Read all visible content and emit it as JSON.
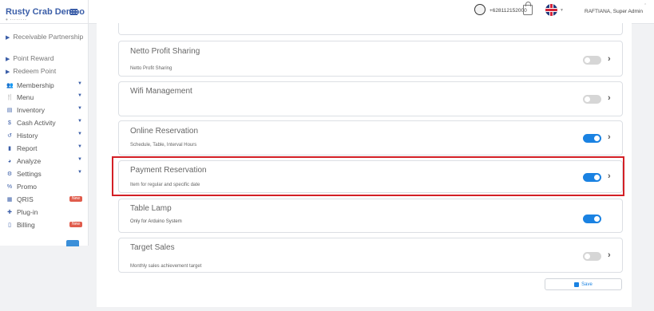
{
  "sidebar": {
    "brand": "Rusty Crab Demoo",
    "submenu": [
      "Receivable Partnership",
      "Point Reward",
      "Redeem Point"
    ],
    "items": [
      {
        "label": "Membership",
        "icon": "users-icon",
        "has_caret": true
      },
      {
        "label": "Menu",
        "icon": "cutlery-icon",
        "has_caret": true
      },
      {
        "label": "Inventory",
        "icon": "box-icon",
        "has_caret": true
      },
      {
        "label": "Cash Activity",
        "icon": "dollar-icon",
        "has_caret": true
      },
      {
        "label": "History",
        "icon": "history-icon",
        "has_caret": true
      },
      {
        "label": "Report",
        "icon": "file-icon",
        "has_caret": true
      },
      {
        "label": "Analyze",
        "icon": "pie-chart-icon",
        "has_caret": true
      },
      {
        "label": "Settings",
        "icon": "gear-icon",
        "has_caret": true
      },
      {
        "label": "Promo",
        "icon": "percent-icon",
        "has_caret": false
      },
      {
        "label": "QRIS",
        "icon": "qr-code-icon",
        "badge": "New"
      },
      {
        "label": "Plug-in",
        "icon": "puzzle-icon",
        "has_caret": false
      },
      {
        "label": "Billing",
        "icon": "receipt-icon",
        "badge": "New"
      }
    ]
  },
  "header": {
    "phone": "+628112152000",
    "user": "RAFTIANA, Super Admin"
  },
  "settings": [
    {
      "title": "Netto Profit Sharing",
      "desc": "Netto Profit Sharing",
      "enabled": false,
      "has_chevron": true
    },
    {
      "title": "Wifi Management",
      "desc": "",
      "enabled": false,
      "has_chevron": true
    },
    {
      "title": "Online Reservation",
      "desc": "Schedule, Table, Interval Hours",
      "enabled": true,
      "has_chevron": true
    },
    {
      "title": "Payment Reservation",
      "desc": "Item for regular and specific date",
      "enabled": true,
      "has_chevron": true
    },
    {
      "title": "Table Lamp",
      "desc": "Only for Arduino System",
      "enabled": true,
      "has_chevron": false
    },
    {
      "title": "Target Sales",
      "desc": "Monthly sales achievement target",
      "enabled": false,
      "has_chevron": true
    }
  ],
  "save_label": "Save",
  "colors": {
    "accent": "#1a82e2",
    "brand": "#3b5ea8",
    "highlight": "#d32026",
    "badge": "#e05c4c"
  }
}
